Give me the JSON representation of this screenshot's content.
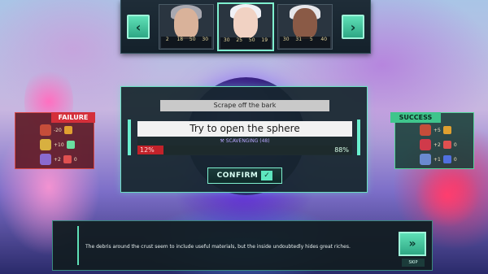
{
  "party": {
    "characters": [
      {
        "name": "character-1",
        "stats": [
          "2",
          "18",
          "50",
          "30"
        ],
        "hair": "#a8a8b0",
        "skin": "#d9b29a",
        "active": false
      },
      {
        "name": "character-2",
        "stats": [
          "30",
          "25",
          "50",
          "19"
        ],
        "hair": "#f0f0f5",
        "skin": "#f1d2c3",
        "active": true
      },
      {
        "name": "character-3",
        "stats": [
          "30",
          "31",
          "5",
          "40"
        ],
        "hair": "#e6e6ea",
        "skin": "#8a5a46",
        "active": false
      }
    ],
    "prev_icon": "chevron-left-icon",
    "next_icon": "chevron-right-icon"
  },
  "event": {
    "title": "Scrape off the bark",
    "option_label": "Try to open the sphere",
    "skill": "SCAVENGING (48)",
    "fail_chance": "12%",
    "success_chance": "88%",
    "fail_fraction": 0.12,
    "confirm_label": "CONFIRM"
  },
  "failure": {
    "label": "FAILURE",
    "rows": [
      {
        "value": "-20"
      },
      {
        "value": "+10"
      },
      {
        "value": "+2",
        "count": "0"
      }
    ]
  },
  "success": {
    "label": "SUCCESS",
    "rows": [
      {
        "value": "+5"
      },
      {
        "value": "+2",
        "count": "0"
      },
      {
        "value": "+1",
        "count": "0"
      }
    ]
  },
  "dialogue": {
    "text": "The debris around the crust seem to include useful materials, but the inside undoubtedly hides great riches.",
    "skip_label": "SKIP"
  },
  "colors": {
    "accent": "#5fe0b7",
    "fail": "#d42f3a",
    "success": "#3fc58c"
  }
}
